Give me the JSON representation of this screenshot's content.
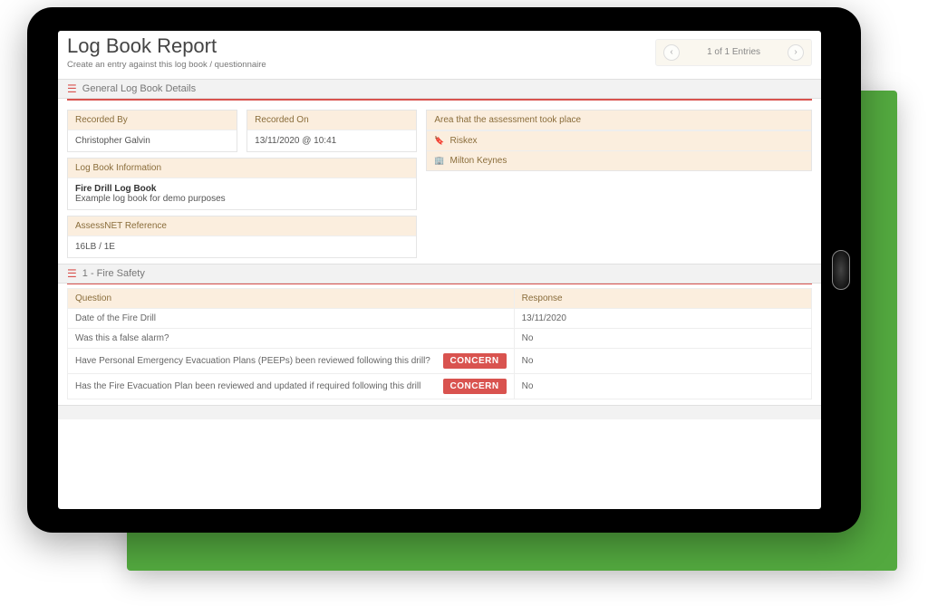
{
  "pageTitle": "Log Book Report",
  "pageSubtitle": "Create an entry against this log book / questionnaire",
  "pager": {
    "text": "1 of 1 Entries",
    "prev": "‹",
    "next": "›"
  },
  "section1": {
    "title": "General Log Book Details"
  },
  "recordedBy": {
    "label": "Recorded By",
    "value": "Christopher Galvin"
  },
  "recordedOn": {
    "label": "Recorded On",
    "value": "13/11/2020 @ 10:41"
  },
  "logInfo": {
    "label": "Log Book Information",
    "name": "Fire Drill Log Book",
    "desc": "Example log book for demo purposes"
  },
  "ref": {
    "label": "AssessNET Reference",
    "value": "16LB / 1E"
  },
  "area": {
    "label": "Area that the assessment took place",
    "items": [
      "Riskex",
      "Milton Keynes"
    ]
  },
  "section2": {
    "title": "1 - Fire Safety"
  },
  "table": {
    "headers": {
      "q": "Question",
      "r": "Response"
    },
    "rows": [
      {
        "q": "Date of the Fire Drill",
        "r": "13/11/2020",
        "concern": false
      },
      {
        "q": "Was this a false alarm?",
        "r": "No",
        "concern": false
      },
      {
        "q": "Have Personal Emergency Evacuation Plans (PEEPs) been reviewed following this drill?",
        "r": "No",
        "concern": true
      },
      {
        "q": "Has the Fire Evacuation Plan been reviewed and updated if required following this drill",
        "r": "No",
        "concern": true
      }
    ],
    "concernLabel": "CONCERN"
  }
}
